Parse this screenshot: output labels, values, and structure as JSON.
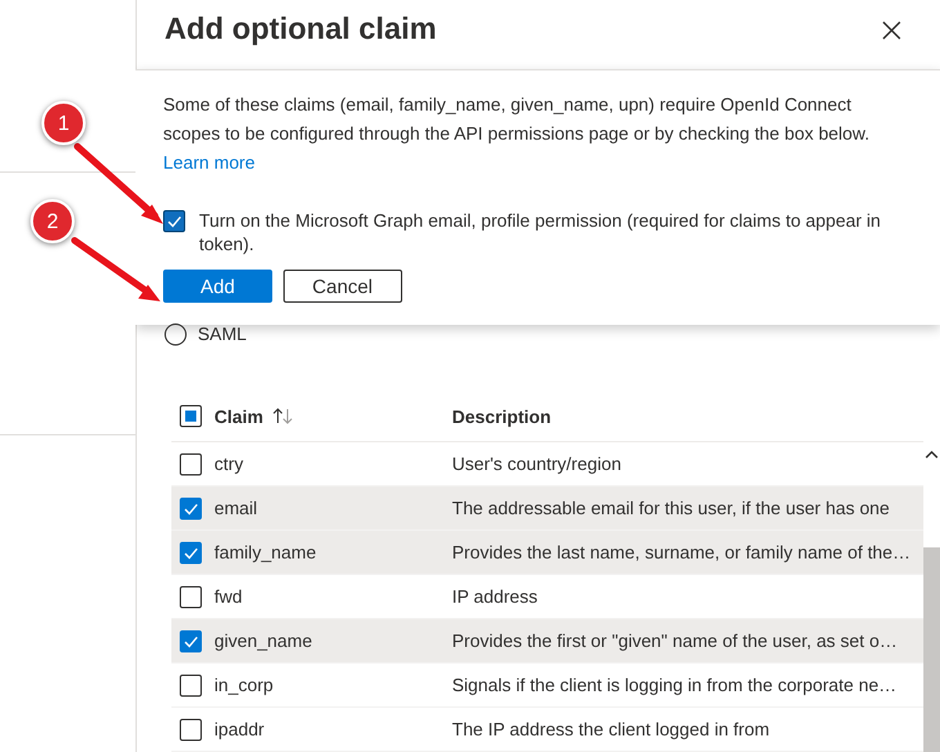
{
  "panel": {
    "title": "Add optional claim"
  },
  "callout": {
    "message": "Some of these claims (email, family_name, given_name, upn) require OpenId Connect scopes to be configured through the API permissions page or by checking the box below.",
    "link": "Learn more",
    "permission": {
      "label": "Turn on the Microsoft Graph email, profile permission (required for claims to appear in token).",
      "checked": true
    },
    "buttons": [
      {
        "label": "Add",
        "kind": "primary"
      },
      {
        "label": "Cancel",
        "kind": "secondary"
      }
    ]
  },
  "token_type": {
    "label": "SAML",
    "selected": false
  },
  "table": {
    "header_checkbox": {
      "indeterminate": true
    },
    "columns": [
      "Claim",
      "Description"
    ],
    "rows": [
      {
        "claim": "ctry",
        "description": "User's country/region",
        "checked": false
      },
      {
        "claim": "email",
        "description": "The addressable email for this user, if the user has one",
        "checked": true
      },
      {
        "claim": "family_name",
        "description": "Provides the last name, surname, or family name of the…",
        "checked": true
      },
      {
        "claim": "fwd",
        "description": "IP address",
        "checked": false
      },
      {
        "claim": "given_name",
        "description": "Provides the first or \"given\" name of the user, as set o…",
        "checked": true
      },
      {
        "claim": "in_corp",
        "description": "Signals if the client is logging in from the corporate ne…",
        "checked": false
      },
      {
        "claim": "ipaddr",
        "description": "The IP address the client logged in from",
        "checked": false
      }
    ]
  },
  "annotations": [
    {
      "number": "1"
    },
    {
      "number": "2"
    }
  ]
}
